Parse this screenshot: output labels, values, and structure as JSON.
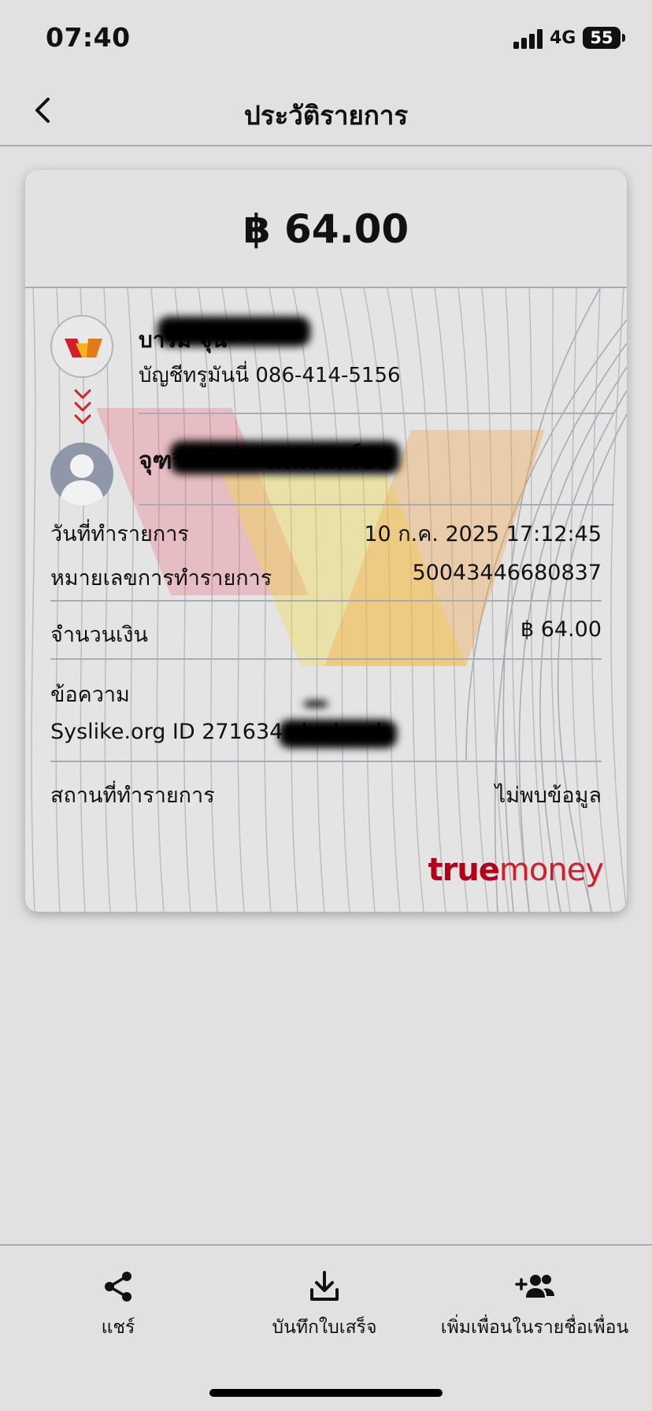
{
  "status_bar": {
    "time": "07:40",
    "network": "4G",
    "battery": "55"
  },
  "nav": {
    "title": "ประวัติรายการ"
  },
  "transaction": {
    "amount_header": "฿ 64.00",
    "sender": {
      "name": "บารมี จุน***",
      "account": "บัญชีทรูมันนี่ 086-414-5156"
    },
    "recipient": {
      "name": "จุฑ******* ัมนัติศักดิ์ชัช"
    },
    "details": {
      "date_label": "วันที่ทำรายการ",
      "date_value": "10 ก.ค. 2025 17:12:45",
      "txid_label": "หมายเลขการทำรายการ",
      "txid_value": "50043446680837",
      "amount_label": "จำนวนเงิน",
      "amount_value": "฿ 64.00",
      "message_label": "ข้อความ",
      "message_value": "Syslike.org ID 271634 ch chard",
      "location_label": "สถานที่ทำรายการ",
      "location_value": "ไม่พบข้อมูล"
    },
    "brand": {
      "part1": "true",
      "part2": "money"
    }
  },
  "actions": [
    {
      "label": "แชร์",
      "icon": "share-icon"
    },
    {
      "label": "บันทึกใบเสร็จ",
      "icon": "download-icon"
    },
    {
      "label": "เพิ่มเพื่อนในรายชื่อเพื่อน",
      "icon": "add-friend-icon"
    }
  ],
  "colors": {
    "background": "#e1e1e1",
    "brand_red": "#c8102e",
    "divider": "#a9acb5"
  }
}
